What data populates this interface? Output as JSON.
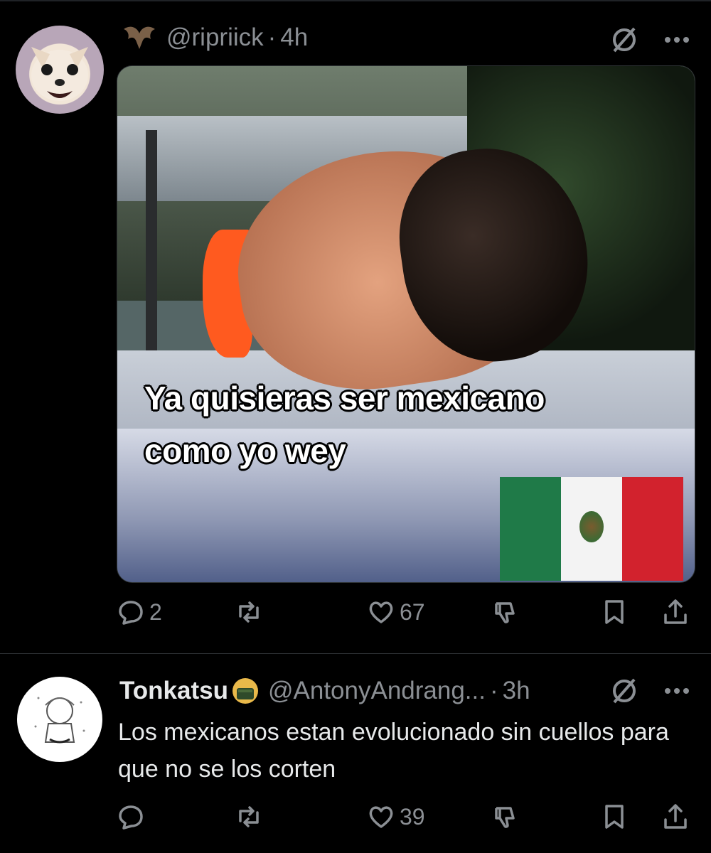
{
  "post1": {
    "handle": "@ripriick",
    "separator": "·",
    "time": "4h",
    "image": {
      "caption_line1": "Ya quisieras ser mexicano",
      "caption_line2": "como yo wey"
    },
    "actions": {
      "replies": "2",
      "reposts": "",
      "likes": "67"
    }
  },
  "post2": {
    "display_name": "Tonkatsu",
    "handle": "@AntonyAndrang...",
    "separator": "·",
    "time": "3h",
    "text": "Los mexicanos estan evolucionado sin cuellos para que no se los corten",
    "actions": {
      "replies": "",
      "reposts": "",
      "likes": "39"
    }
  },
  "colors": {
    "background": "#000000",
    "text_primary": "#e7e9ea",
    "text_secondary": "#8b8f94",
    "divider": "#2f3336"
  },
  "icons": {
    "more": "more-icon",
    "grok": "grok-icon",
    "reply": "reply-icon",
    "repost": "repost-icon",
    "like": "heart-icon",
    "downvote": "downvote-icon",
    "bookmark": "bookmark-icon",
    "share": "share-icon"
  }
}
